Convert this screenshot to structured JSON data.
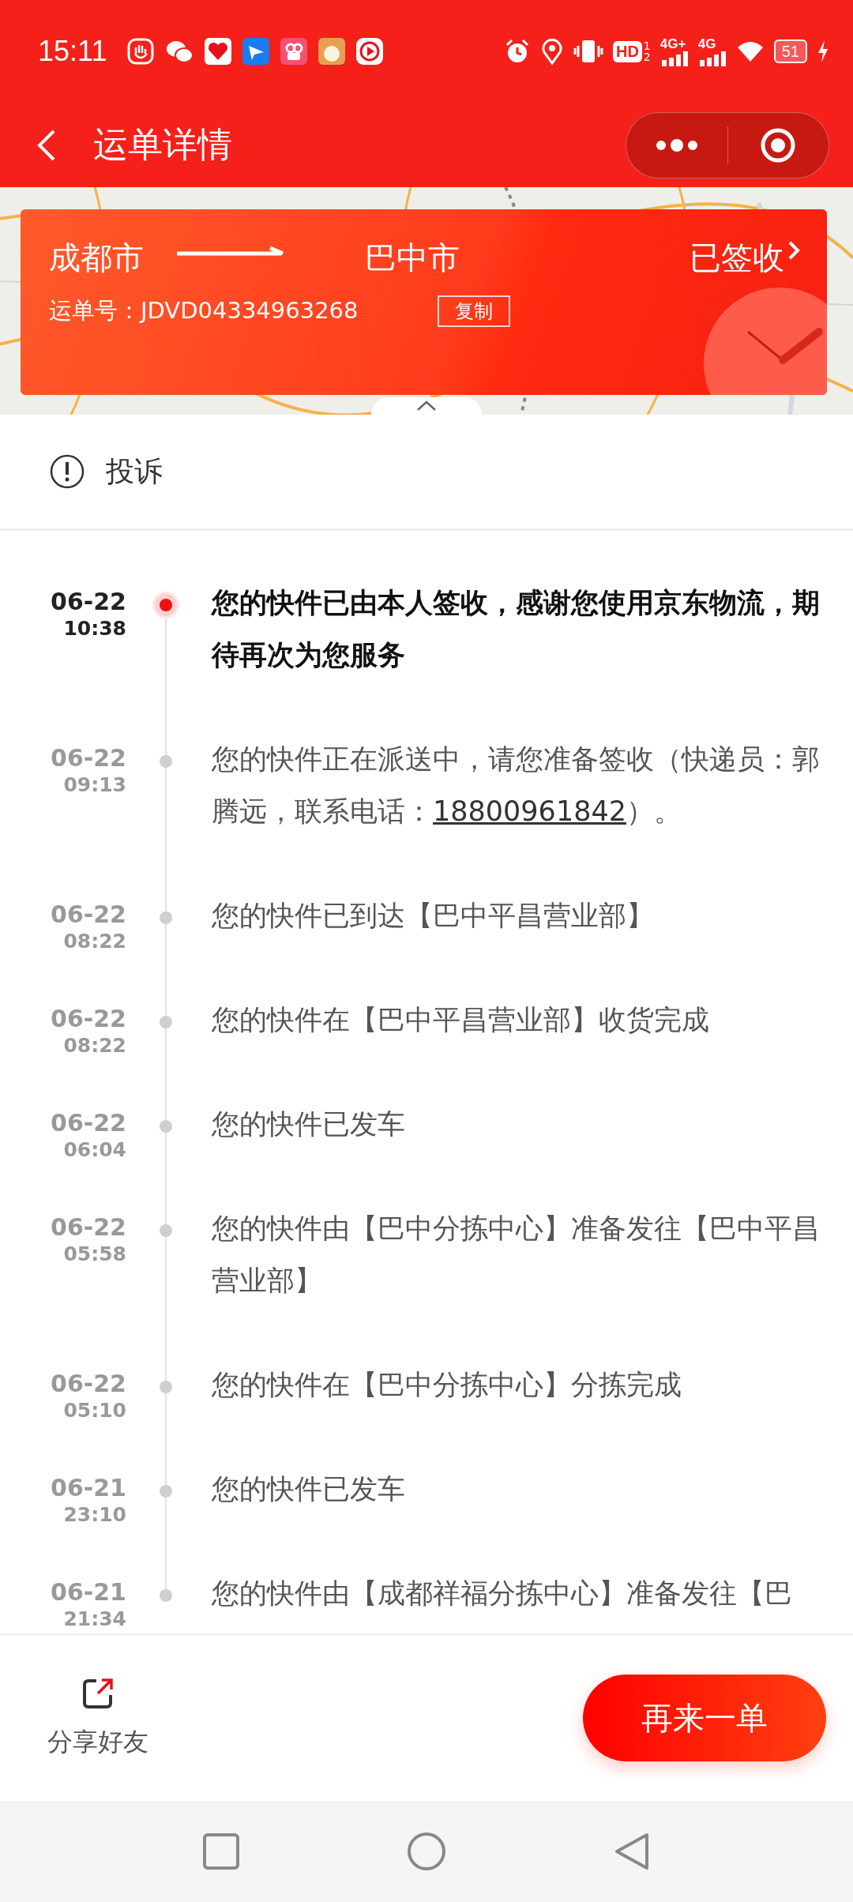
{
  "status_bar": {
    "time": "15:11",
    "hd": "HD",
    "hd_slots": [
      "1",
      "2"
    ],
    "network_1": "4G+",
    "network_2": "4G",
    "battery": "51"
  },
  "header": {
    "title": "运单详情"
  },
  "route_card": {
    "from": "成都市",
    "to": "巴中市",
    "status": "已签收",
    "waybill_label": "运单号：",
    "waybill_number": "JDVD04334963268",
    "copy_button": "复制"
  },
  "complaint": {
    "label": "投诉"
  },
  "timeline": [
    {
      "date": "06-22",
      "time": "10:38",
      "text": "您的快件已由本人签收，感谢您使用京东物流，期待再次为您服务",
      "current": true
    },
    {
      "date": "06-22",
      "time": "09:13",
      "text": "您的快件正在派送中，请您准备签收（快递员：郭腾远，联系电话：",
      "link": "18800961842",
      "text_end": "）。",
      "current": false
    },
    {
      "date": "06-22",
      "time": "08:22",
      "text": "您的快件已到达【巴中平昌营业部】",
      "current": false
    },
    {
      "date": "06-22",
      "time": "08:22",
      "text": "您的快件在【巴中平昌营业部】收货完成",
      "current": false
    },
    {
      "date": "06-22",
      "time": "06:04",
      "text": "您的快件已发车",
      "current": false
    },
    {
      "date": "06-22",
      "time": "05:58",
      "text": "您的快件由【巴中分拣中心】准备发往【巴中平昌营业部】",
      "current": false
    },
    {
      "date": "06-22",
      "time": "05:10",
      "text": "您的快件在【巴中分拣中心】分拣完成",
      "current": false
    },
    {
      "date": "06-21",
      "time": "23:10",
      "text": "您的快件已发车",
      "current": false
    },
    {
      "date": "06-21",
      "time": "21:34",
      "text": "您的快件由【成都祥福分拣中心】准备发往【巴",
      "current": false
    }
  ],
  "bottom_bar": {
    "share_label": "分享好友",
    "reorder_button": "再来一单"
  }
}
